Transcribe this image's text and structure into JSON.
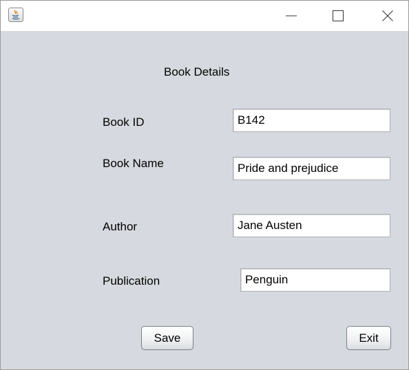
{
  "titlebar": {
    "icon": "java-cup-icon",
    "buttons": {
      "minimize": "minimize-icon",
      "maximize": "maximize-icon",
      "close": "close-icon"
    }
  },
  "form": {
    "heading": "Book Details",
    "book_id_label": "Book ID",
    "book_id_value": "B142",
    "book_name_label": "Book Name",
    "book_name_value": "Pride and prejudice",
    "author_label": "Author",
    "author_value": "Jane Austen",
    "publication_label": "Publication",
    "publication_value": "Penguin",
    "save_label": "Save",
    "exit_label": "Exit"
  },
  "colors": {
    "panel_background": "#d6d9df",
    "titlebar_background": "#ffffff",
    "java_icon_orange": "#e76f00",
    "java_icon_blue": "#3d6c9c"
  }
}
